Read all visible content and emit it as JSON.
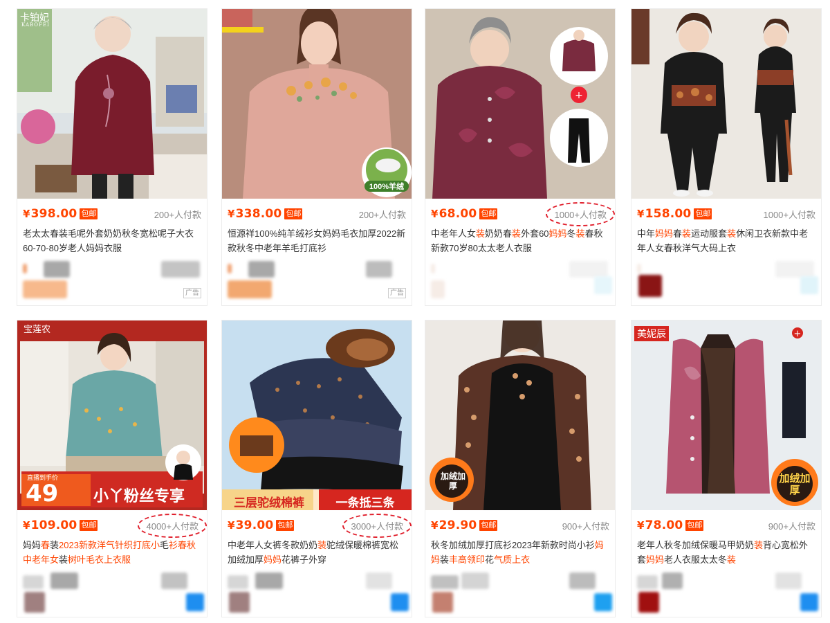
{
  "currency_symbol": "¥",
  "free_shipping_label": "包邮",
  "ad_label": "广告",
  "colors": {
    "price": "#ff4400",
    "highlight": "#ff4400",
    "circle": "#e01e2b"
  },
  "products": [
    {
      "price": "398.00",
      "paid": "200+人付款",
      "title": "老太太春装毛呢外套奶奶秋冬宽松呢子大衣60-70-80岁老人妈妈衣服",
      "ad": true,
      "brand_logo": "卡铂妃",
      "brand_sub": "KABOFEI",
      "badge": ""
    },
    {
      "price": "338.00",
      "paid": "200+人付款",
      "title": "恒源祥100%纯羊绒衫女妈妈毛衣加厚2022新款秋冬中老年羊毛打底衫",
      "ad": true,
      "badge": "100%羊绒"
    },
    {
      "price": "68.00",
      "paid": "1000+人付款",
      "title_parts": [
        "中老年人女",
        "装",
        "奶奶春",
        "装",
        "外套60",
        "妈妈",
        "冬",
        "装",
        "春秋新款70岁80太太老人衣服"
      ],
      "ad": false
    },
    {
      "price": "158.00",
      "paid": "1000+人付款",
      "title_parts": [
        "中年",
        "妈妈",
        "春",
        "装",
        "运动服套",
        "装",
        "休闲卫衣新款中老年人女春秋洋气大码上衣"
      ],
      "ad": false
    },
    {
      "price": "109.00",
      "paid": "4000+人付款",
      "title_parts": [
        "妈妈",
        "春",
        "装",
        "2023新款洋气针织打底小",
        "毛",
        "衫春秋中老年女",
        "装",
        "树叶毛衣上衣服"
      ],
      "ad": false,
      "brand_logo": "宝莲农",
      "promo_price": "49",
      "promo_top": "直播到手价",
      "promo_text": "小丫粉丝专享"
    },
    {
      "price": "39.00",
      "paid": "3000+人付款",
      "title_parts": [
        "中老年人女裤冬款奶奶",
        "装",
        "驼绒保暖棉裤宽松加绒加厚",
        "妈妈",
        "花裤子外穿"
      ],
      "ad": false,
      "banner_left": "三层驼绒棉裤",
      "banner_right": "一条抵三条"
    },
    {
      "price": "29.90",
      "paid": "900+人付款",
      "title_parts": [
        "秋冬加绒加厚打底衫2023年新款时尚小衫",
        "妈妈",
        "装",
        "丰高领印",
        "花",
        "气质上衣"
      ],
      "ad": false,
      "badge": "加绒加厚"
    },
    {
      "price": "78.00",
      "paid": "900+人付款",
      "title_parts": [
        "老年人秋冬加绒保暖马甲奶奶",
        "装",
        "背心宽松外套",
        "妈妈",
        "老人衣服太太冬",
        "装"
      ],
      "ad": false,
      "brand_logo": "美妮辰",
      "badge": "加绒加厚"
    }
  ]
}
